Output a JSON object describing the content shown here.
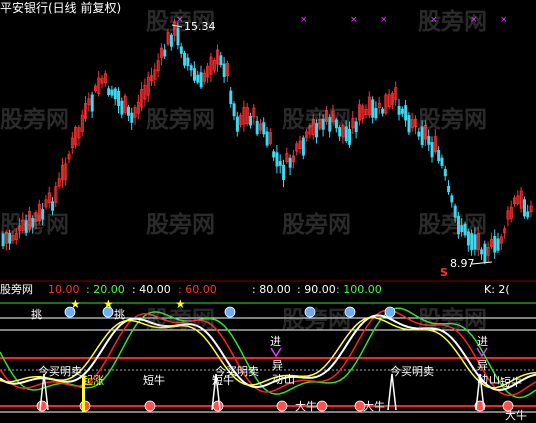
{
  "title": "平安银行(日线 前复权)",
  "watermark_text": "股旁网",
  "upper_panel": {
    "high_label": "15.34",
    "low_label": "8.97",
    "sell_marker": "S"
  },
  "indicator_bar": {
    "name": "股旁网",
    "levels": [
      {
        "text": "10.00",
        "color": "#ff3030"
      },
      {
        "text": ": 20.00",
        "color": "#40ff40"
      },
      {
        "text": ": 40.00",
        "color": "#ffffff"
      },
      {
        "text": ": 60.00",
        "color": "#ff3030"
      },
      {
        "text": ": 80.00",
        "color": "#ffffff"
      },
      {
        "text": ": 90.00",
        "color": "#ffffff"
      },
      {
        "text": ": 100.00",
        "color": "#40ff40"
      }
    ],
    "k_label": "K: 2("
  },
  "lower_panel_labels": {
    "jin": "进",
    "yi": "异",
    "dong": "动",
    "ling": "山",
    "duan_niu": "短牛",
    "da_niu": "大牛",
    "qi_zhang": "起涨",
    "jin_mai_ming_mai": "今买明卖",
    "tiao": "挑"
  },
  "colors": {
    "up_candle": "#ff3030",
    "down_candle": "#40d8f0",
    "line_white": "#ffffff",
    "line_yellow": "#ffff30",
    "line_green": "#30e030",
    "line_red": "#ff2020",
    "accent_magenta": "#e040ff"
  }
}
